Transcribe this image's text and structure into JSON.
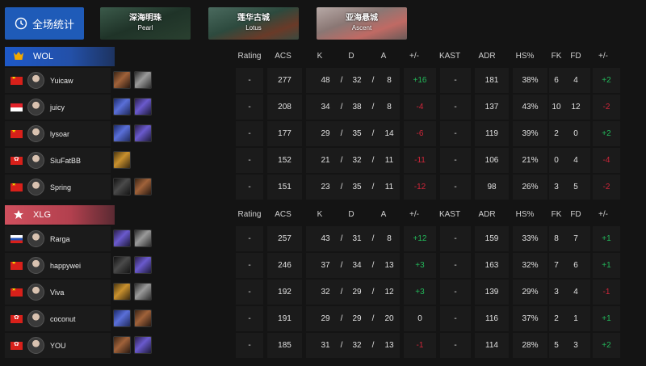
{
  "top": {
    "all_stats_label": "全场统计",
    "maps": [
      {
        "cn": "深海明珠",
        "en": "Pearl"
      },
      {
        "cn": "莲华古城",
        "en": "Lotus"
      },
      {
        "cn": "亚海悬城",
        "en": "Ascent"
      }
    ]
  },
  "headers": {
    "rating": "Rating",
    "acs": "ACS",
    "k": "K",
    "d": "D",
    "a": "A",
    "pm": "+/-",
    "kast": "KAST",
    "adr": "ADR",
    "hs": "HS%",
    "fk": "FK",
    "fd": "FD",
    "pm2": "+/-"
  },
  "teams": [
    {
      "name": "WOL",
      "color": "#1e59c8",
      "players": [
        {
          "name": "Yuicaw",
          "flag": "cn",
          "agents": [
            "brown",
            "grey"
          ],
          "rating": "-",
          "acs": "277",
          "k": "48",
          "sep1": "/",
          "d": "32",
          "sep2": "/",
          "a": "8",
          "pm": "+16",
          "kast": "-",
          "adr": "181",
          "hs": "38%",
          "fk": "6",
          "fd": "4",
          "pm2": "+2"
        },
        {
          "name": "juicy",
          "flag": "id",
          "agents": [
            "blue",
            "purple"
          ],
          "rating": "-",
          "acs": "208",
          "k": "34",
          "sep1": "/",
          "d": "38",
          "sep2": "/",
          "a": "8",
          "pm": "-4",
          "kast": "-",
          "adr": "137",
          "hs": "43%",
          "fk": "10",
          "fd": "12",
          "pm2": "-2"
        },
        {
          "name": "lysoar",
          "flag": "cn",
          "agents": [
            "blue",
            "purple"
          ],
          "rating": "-",
          "acs": "177",
          "k": "29",
          "sep1": "/",
          "d": "35",
          "sep2": "/",
          "a": "14",
          "pm": "-6",
          "kast": "-",
          "adr": "119",
          "hs": "39%",
          "fk": "2",
          "fd": "0",
          "pm2": "+2"
        },
        {
          "name": "SiuFatBB",
          "flag": "hk",
          "agents": [
            "gold"
          ],
          "rating": "-",
          "acs": "152",
          "k": "21",
          "sep1": "/",
          "d": "32",
          "sep2": "/",
          "a": "11",
          "pm": "-11",
          "kast": "-",
          "adr": "106",
          "hs": "21%",
          "fk": "0",
          "fd": "4",
          "pm2": "-4"
        },
        {
          "name": "Spring",
          "flag": "cn",
          "agents": [
            "dark",
            "brown"
          ],
          "rating": "-",
          "acs": "151",
          "k": "23",
          "sep1": "/",
          "d": "35",
          "sep2": "/",
          "a": "11",
          "pm": "-12",
          "kast": "-",
          "adr": "98",
          "hs": "26%",
          "fk": "3",
          "fd": "5",
          "pm2": "-2"
        }
      ]
    },
    {
      "name": "XLG",
      "color": "#d0505e",
      "players": [
        {
          "name": "Rarga",
          "flag": "ru",
          "agents": [
            "purple",
            "grey"
          ],
          "rating": "-",
          "acs": "257",
          "k": "43",
          "sep1": "/",
          "d": "31",
          "sep2": "/",
          "a": "8",
          "pm": "+12",
          "kast": "-",
          "adr": "159",
          "hs": "33%",
          "fk": "8",
          "fd": "7",
          "pm2": "+1"
        },
        {
          "name": "happywei",
          "flag": "cn",
          "agents": [
            "dark",
            "purple"
          ],
          "rating": "-",
          "acs": "246",
          "k": "37",
          "sep1": "/",
          "d": "34",
          "sep2": "/",
          "a": "13",
          "pm": "+3",
          "kast": "-",
          "adr": "163",
          "hs": "32%",
          "fk": "7",
          "fd": "6",
          "pm2": "+1"
        },
        {
          "name": "Viva",
          "flag": "cn",
          "agents": [
            "gold",
            "grey"
          ],
          "rating": "-",
          "acs": "192",
          "k": "32",
          "sep1": "/",
          "d": "29",
          "sep2": "/",
          "a": "12",
          "pm": "+3",
          "kast": "-",
          "adr": "139",
          "hs": "29%",
          "fk": "3",
          "fd": "4",
          "pm2": "-1"
        },
        {
          "name": "coconut",
          "flag": "hk",
          "agents": [
            "blue",
            "brown"
          ],
          "rating": "-",
          "acs": "191",
          "k": "29",
          "sep1": "/",
          "d": "29",
          "sep2": "/",
          "a": "20",
          "pm": "0",
          "kast": "-",
          "adr": "116",
          "hs": "37%",
          "fk": "2",
          "fd": "1",
          "pm2": "+1"
        },
        {
          "name": "YOU",
          "flag": "hk",
          "agents": [
            "brown",
            "purple"
          ],
          "rating": "-",
          "acs": "185",
          "k": "31",
          "sep1": "/",
          "d": "32",
          "sep2": "/",
          "a": "13",
          "pm": "-1",
          "kast": "-",
          "adr": "114",
          "hs": "28%",
          "fk": "5",
          "fd": "3",
          "pm2": "+2"
        }
      ]
    }
  ]
}
